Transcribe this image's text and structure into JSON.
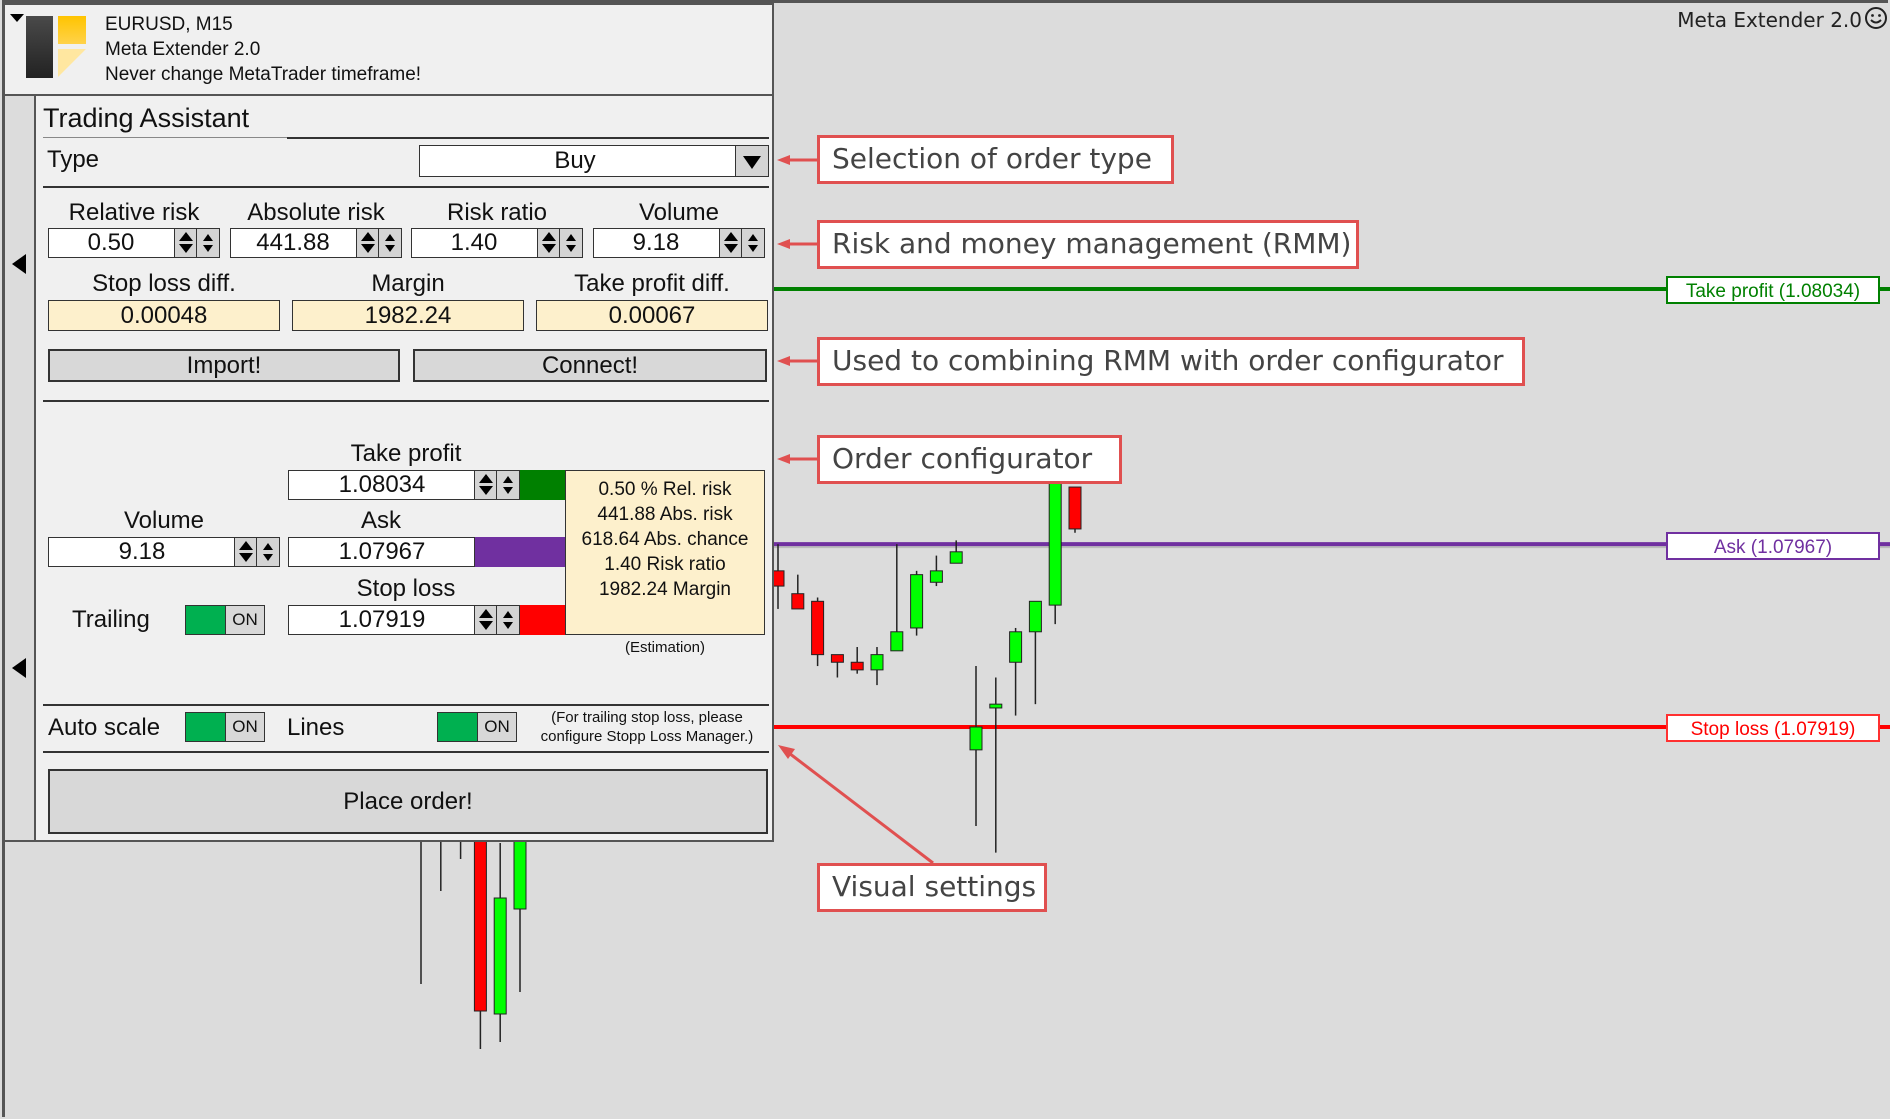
{
  "brand": "Meta Extender 2.0",
  "header": {
    "symbol": "EURUSD, M15",
    "app_name": "Meta Extender 2.0",
    "warning": "Never change MetaTrader timeframe!"
  },
  "panel": {
    "title": "Trading Assistant",
    "type_label": "Type",
    "type_value": "Buy",
    "rmm": {
      "fields": [
        {
          "label": "Relative risk",
          "value": "0.50"
        },
        {
          "label": "Absolute risk",
          "value": "441.88"
        },
        {
          "label": "Risk ratio",
          "value": "1.40"
        },
        {
          "label": "Volume",
          "value": "9.18"
        }
      ],
      "readonly": [
        {
          "label": "Stop loss diff.",
          "value": "0.00048"
        },
        {
          "label": "Margin",
          "value": "1982.24"
        },
        {
          "label": "Take profit diff.",
          "value": "0.00067"
        }
      ],
      "import_label": "Import!",
      "connect_label": "Connect!"
    },
    "order": {
      "take_profit_label": "Take profit",
      "take_profit_value": "1.08034",
      "volume_label": "Volume",
      "volume_value": "9.18",
      "ask_label": "Ask",
      "ask_value": "1.07967",
      "stop_loss_label": "Stop loss",
      "stop_loss_value": "1.07919",
      "trailing_label": "Trailing",
      "trailing_state": "ON",
      "info": [
        "0.50 % Rel. risk",
        "441.88 Abs. risk",
        "618.64 Abs. chance",
        "1.40 Risk ratio",
        "1982.24 Margin"
      ],
      "estimation_note": "(Estimation)"
    },
    "visual": {
      "auto_scale_label": "Auto scale",
      "auto_scale_state": "ON",
      "lines_label": "Lines",
      "lines_state": "ON",
      "note_line1": "(For trailing stop loss, please",
      "note_line2": "configure Stopp Loss Manager.)"
    },
    "place_order_label": "Place order!"
  },
  "colors": {
    "take_profit": "#008000",
    "ask": "#7030a0",
    "stop_loss": "#ff0000",
    "bull": "#00ff00",
    "bear": "#ff0000",
    "toggle_on": "#00b050",
    "callout": "#e05050"
  },
  "callouts": [
    {
      "id": "order-type",
      "text": "Selection of order type"
    },
    {
      "id": "rmm",
      "text": "Risk and money management (RMM)"
    },
    {
      "id": "connect",
      "text": "Used to combining RMM with order configurator"
    },
    {
      "id": "configurator",
      "text": "Order configurator"
    },
    {
      "id": "visual",
      "text": "Visual settings"
    }
  ],
  "chart_data": {
    "type": "candlestick",
    "symbol": "EURUSD",
    "timeframe": "M15",
    "lines": [
      {
        "name": "Take profit",
        "label": "Take profit (1.08034)",
        "price": 1.08034
      },
      {
        "name": "Ask",
        "label": "Ask (1.07967)",
        "price": 1.07967
      },
      {
        "name": "Stop loss",
        "label": "Stop loss (1.07919)",
        "price": 1.07919
      }
    ],
    "candles": [
      {
        "open": 1.07865,
        "close": 1.07817,
        "high": 1.07865,
        "low": 1.07845,
        "partial": "below-panel",
        "slot": 0,
        "wick_only": true,
        "low_ext": 1.07858
      },
      {
        "open": 1.07865,
        "close": 1.07865,
        "high": 1.07865,
        "low": 1.07882,
        "slot": 1,
        "wick_only": true
      },
      {
        "open": 1.07865,
        "close": 1.07865,
        "high": 1.07865,
        "low": 1.0789,
        "slot": 2,
        "wick_only": true
      },
      {
        "open": 1.07865,
        "close": 1.0782,
        "high": 1.07865,
        "low": 1.0781,
        "slot": 3
      },
      {
        "open": 1.07815,
        "close": 1.07845,
        "high": 1.07865,
        "low": 1.07808,
        "slot": 4
      },
      {
        "open": 1.0785,
        "close": 1.07865,
        "high": 1.07865,
        "low": 1.07829,
        "slot": 5
      },
      {
        "open": 1.0796,
        "close": 1.07956,
        "high": 1.07967,
        "low": 1.0795,
        "slot": 18
      },
      {
        "open": 1.07954,
        "close": 1.0795,
        "high": 1.07959,
        "low": 1.07952,
        "slot": 19
      },
      {
        "open": 1.07952,
        "close": 1.07938,
        "high": 1.07953,
        "low": 1.07935,
        "slot": 20
      },
      {
        "open": 1.07938,
        "close": 1.07936,
        "high": 1.07938,
        "low": 1.07932,
        "slot": 21
      },
      {
        "open": 1.07936,
        "close": 1.07934,
        "high": 1.0794,
        "low": 1.07933,
        "slot": 22
      },
      {
        "open": 1.07934,
        "close": 1.07938,
        "high": 1.0794,
        "low": 1.0793,
        "slot": 23
      },
      {
        "open": 1.07939,
        "close": 1.07944,
        "high": 1.07967,
        "low": 1.07939,
        "slot": 24
      },
      {
        "open": 1.07945,
        "close": 1.07959,
        "high": 1.0796,
        "low": 1.07943,
        "slot": 25
      },
      {
        "open": 1.07957,
        "close": 1.0796,
        "high": 1.07964,
        "low": 1.07956,
        "slot": 26
      },
      {
        "open": 1.07962,
        "close": 1.07965,
        "high": 1.07968,
        "low": 1.07962,
        "slot": 27
      },
      {
        "open": 1.07913,
        "close": 1.07919,
        "high": 1.07935,
        "low": 1.07893,
        "slot": 28
      },
      {
        "open": 1.07924,
        "close": 1.07925,
        "high": 1.07932,
        "low": 1.07886,
        "slot": 29
      },
      {
        "open": 1.07936,
        "close": 1.07944,
        "high": 1.07945,
        "low": 1.07922,
        "slot": 30
      },
      {
        "open": 1.07944,
        "close": 1.07952,
        "high": 1.07947,
        "low": 1.07925,
        "slot": 31
      },
      {
        "open": 1.07951,
        "close": 1.07983,
        "high": 1.07983,
        "low": 1.07946,
        "slot": 32
      },
      {
        "open": 1.07982,
        "close": 1.07971,
        "high": 1.07982,
        "low": 1.0797,
        "slot": 33
      }
    ]
  }
}
